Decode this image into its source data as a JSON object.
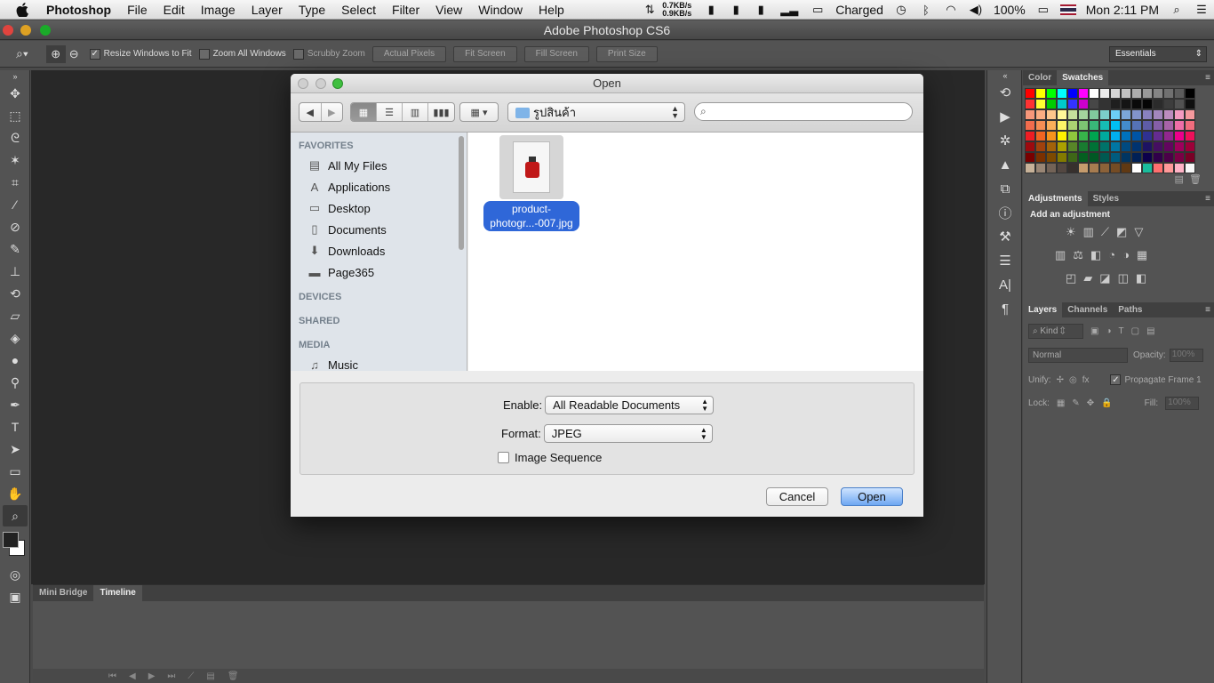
{
  "menubar": {
    "app_name": "Photoshop",
    "items": [
      "File",
      "Edit",
      "Image",
      "Layer",
      "Type",
      "Select",
      "Filter",
      "View",
      "Window",
      "Help"
    ],
    "net_up": "0.7KB/s",
    "net_down": "0.9KB/s",
    "battery_status": "Charged",
    "volume_percent": "100%",
    "clock": "Mon 2:11 PM"
  },
  "window": {
    "title": "Adobe Photoshop CS6"
  },
  "options_bar": {
    "resize_windows": "Resize Windows to Fit",
    "zoom_all": "Zoom All Windows",
    "scrubby_zoom": "Scrubby Zoom",
    "actual_pixels": "Actual Pixels",
    "fit_screen": "Fit Screen",
    "fill_screen": "Fill Screen",
    "print_size": "Print Size",
    "workspace": "Essentials"
  },
  "dialog": {
    "title": "Open",
    "path": "รูปสินค้า",
    "sidebar": {
      "favorites_header": "FAVORITES",
      "favorites": [
        "All My Files",
        "Applications",
        "Desktop",
        "Documents",
        "Downloads",
        "Page365"
      ],
      "devices_header": "DEVICES",
      "shared_header": "SHARED",
      "media_header": "MEDIA",
      "media": [
        "Music"
      ]
    },
    "file": {
      "line1": "product-",
      "line2": "photogr...-007.jpg"
    },
    "enable_label": "Enable:",
    "enable_value": "All Readable Documents",
    "format_label": "Format:",
    "format_value": "JPEG",
    "image_sequence": "Image Sequence",
    "cancel": "Cancel",
    "open": "Open"
  },
  "bottom_panel": {
    "tabs": [
      "Mini Bridge",
      "Timeline"
    ],
    "active": "Timeline"
  },
  "right_panels": {
    "color_tabs": [
      "Color",
      "Swatches"
    ],
    "adjust_tabs": [
      "Adjustments",
      "Styles"
    ],
    "add_adjustment": "Add an adjustment",
    "layer_tabs": [
      "Layers",
      "Channels",
      "Paths"
    ],
    "kind": "Kind",
    "blend_mode": "Normal",
    "opacity_label": "Opacity:",
    "opacity_value": "100%",
    "unify_label": "Unify:",
    "propagate": "Propagate Frame 1",
    "lock_label": "Lock:",
    "fill_label": "Fill:",
    "fill_value": "100%"
  },
  "swatch_colors": [
    "#ff0000",
    "#ffff00",
    "#00ff00",
    "#00ffff",
    "#0000ff",
    "#ff00ff",
    "#ffffff",
    "#ebebeb",
    "#d6d6d6",
    "#c2c2c2",
    "#adadad",
    "#999999",
    "#858585",
    "#707070",
    "#5c5c5c",
    "#000000",
    "#ff3333",
    "#ffff33",
    "#00cc00",
    "#00cccc",
    "#3333ff",
    "#cc00cc",
    "#474747",
    "#333333",
    "#1f1f1f",
    "#141414",
    "#0a0a0a",
    "#050505",
    "#2b2b2b",
    "#3d3d3d",
    "#525252",
    "#0f0f0f",
    "#f7977a",
    "#fbad82",
    "#fdc68c",
    "#fff799",
    "#c6df9c",
    "#a4d49d",
    "#81ca9d",
    "#7bcdc9",
    "#6ccff7",
    "#7ca6d8",
    "#8293ca",
    "#8881be",
    "#a286bd",
    "#bc8cbf",
    "#f49bc1",
    "#f5999d",
    "#f16c4d",
    "#f68e54",
    "#fbaf5a",
    "#fff467",
    "#acd372",
    "#7dc473",
    "#39b778",
    "#16bcb4",
    "#00bff3",
    "#438ccb",
    "#5573b7",
    "#5e5ca7",
    "#855fa8",
    "#a763a9",
    "#ef6ea8",
    "#f16d7e",
    "#ee1d24",
    "#f16522",
    "#f7941d",
    "#fff100",
    "#8fc63d",
    "#37b44a",
    "#00a650",
    "#00a99e",
    "#00aeef",
    "#0072bc",
    "#0054a5",
    "#2f3192",
    "#652c91",
    "#91278f",
    "#ec008c",
    "#ee105a",
    "#9d0a0f",
    "#a1410d",
    "#a36209",
    "#aba000",
    "#588528",
    "#197b30",
    "#007236",
    "#00736a",
    "#0076a4",
    "#004a80",
    "#003370",
    "#1d1363",
    "#450e61",
    "#62055f",
    "#9e005c",
    "#9d0039",
    "#790000",
    "#7b3000",
    "#7c4900",
    "#827a00",
    "#3e6617",
    "#045f20",
    "#005824",
    "#005951",
    "#005b7e",
    "#003562",
    "#002056",
    "#0c004b",
    "#30004a",
    "#4b0048",
    "#7a0045",
    "#7a0026",
    "#c7b299",
    "#998675",
    "#736357",
    "#534741",
    "#37302d",
    "#c69c6d",
    "#a77c50",
    "#8c6239",
    "#754c24",
    "#603913",
    "#ffffff",
    "#1abc9c",
    "#ff6f6f",
    "#ff9999",
    "#ffb3c6",
    "#f7f7f7"
  ]
}
